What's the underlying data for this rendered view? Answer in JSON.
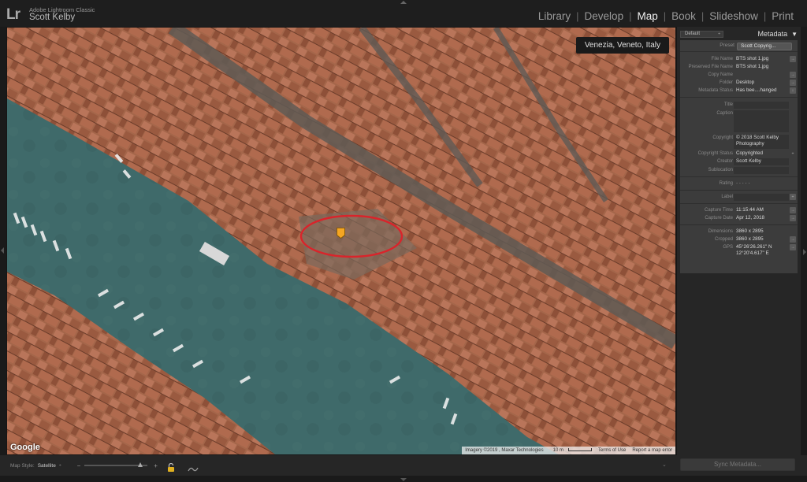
{
  "app": {
    "logo": "Lr",
    "name": "Adobe Lightroom Classic",
    "user": "Scott Kelby"
  },
  "modules": [
    {
      "label": "Library",
      "active": false
    },
    {
      "label": "Develop",
      "active": false
    },
    {
      "label": "Map",
      "active": true
    },
    {
      "label": "Book",
      "active": false
    },
    {
      "label": "Slideshow",
      "active": false
    },
    {
      "label": "Print",
      "active": false
    }
  ],
  "map": {
    "location_label": "Venezia, Veneto, Italy",
    "google_label": "Google",
    "attribution": {
      "imagery": "Imagery ©2019 , Maxar Technologies",
      "scale": "10 m",
      "terms": "Terms of Use",
      "report": "Report a map error"
    },
    "marker_color": "#f5a623",
    "circle_color": "#d9242b"
  },
  "metadata_panel": {
    "default_select": "Default",
    "title": "Metadata",
    "collapse_glyph": "▼",
    "preset_label": "Preset",
    "preset_value": "Scott Copyrig...",
    "rows": [
      {
        "label": "File Name",
        "value": "BTS shot 1.jpg"
      },
      {
        "label": "Preserved File Name",
        "value": "BTS shot 1.jpg"
      },
      {
        "label": "Copy Name",
        "value": ""
      },
      {
        "label": "Folder",
        "value": "Desktop"
      },
      {
        "label": "Metadata Status",
        "value": "Has bee....hanged"
      },
      {
        "label": "Title",
        "value": ""
      },
      {
        "label": "Caption",
        "value": ""
      },
      {
        "label": "Copyright",
        "value": "© 2018 Scott Kelby",
        "value2": "Photography"
      },
      {
        "label": "Copyright Status",
        "value": "Copyrighted"
      },
      {
        "label": "Creator",
        "value": "Scott Kelby"
      },
      {
        "label": "Sublocation",
        "value": ""
      },
      {
        "label": "Rating",
        "value": "·   ·   ·   ·   ·"
      },
      {
        "label": "Label",
        "value": ""
      },
      {
        "label": "Capture Time",
        "value": "11:15:44 AM"
      },
      {
        "label": "Capture Date",
        "value": "Apr 12, 2018"
      },
      {
        "label": "Dimensions",
        "value": "3860 x 2895"
      },
      {
        "label": "Cropped",
        "value": "3860 x 2895"
      },
      {
        "label": "GPS",
        "value": "45°26'26.261\" N",
        "value2": "12°20'4.617\" E"
      }
    ]
  },
  "toolbar": {
    "map_style_label": "Map Style:",
    "map_style_value": "Satellite",
    "map_style_arrow": "÷",
    "zoom_minus": "−",
    "zoom_plus": "+",
    "zoom_level": 0.88,
    "sync_metadata": "Sync Metadata..."
  }
}
